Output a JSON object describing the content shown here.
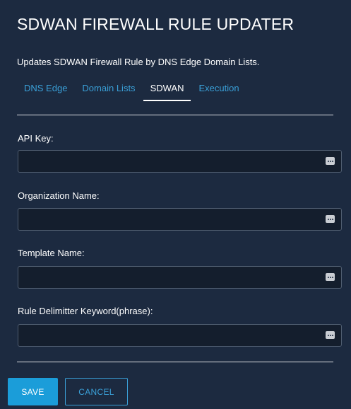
{
  "page": {
    "title": "SDWAN FIREWALL RULE UPDATER",
    "subtitle": "Updates SDWAN Firewall Rule by DNS Edge Domain Lists."
  },
  "tabs": [
    {
      "label": "DNS Edge",
      "active": false
    },
    {
      "label": "Domain Lists",
      "active": false
    },
    {
      "label": "SDWAN",
      "active": true
    },
    {
      "label": "Execution",
      "active": false
    }
  ],
  "form": {
    "api_key": {
      "label": "API Key:",
      "value": ""
    },
    "organization_name": {
      "label": "Organization Name:",
      "value": ""
    },
    "template_name": {
      "label": "Template Name:",
      "value": ""
    },
    "rule_delimitter": {
      "label": "Rule Delimitter Keyword(phrase):",
      "value": ""
    }
  },
  "buttons": {
    "save": "SAVE",
    "cancel": "CANCEL"
  },
  "colors": {
    "background": "#1c2a40",
    "accent": "#1b9dd9",
    "link": "#3aa0d8",
    "field_background": "#141e2d"
  },
  "icons": {
    "field_action": "more-dots-icon"
  }
}
